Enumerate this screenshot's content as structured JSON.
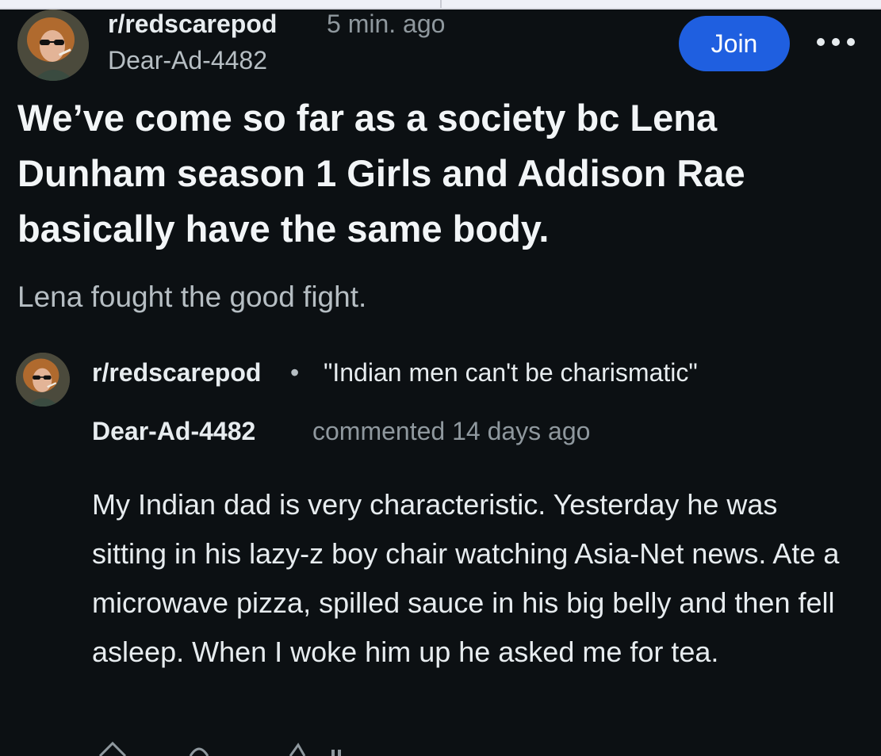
{
  "post": {
    "subreddit": "r/redscarepod",
    "time": "5 min. ago",
    "username": "Dear-Ad-4482",
    "join_label": "Join",
    "title": "We’ve come so far as a society bc Lena Dunham season 1 Girls and Addison Rae basically have the same body.",
    "body": "Lena fought the good fight."
  },
  "comment": {
    "subreddit": "r/redscarepod",
    "separator": "•",
    "post_title": "\"Indian men can't be charismatic\"",
    "username": "Dear-Ad-4482",
    "meta": "commented 14 days ago",
    "body": "My Indian dad is very characteristic. Yesterday he was sitting in his lazy-z boy chair watching Asia-Net news. Ate a microwave pizza, spilled sauce in his big belly and then fell asleep. When I woke him up he asked me for tea."
  },
  "icons": {
    "more": "more-options-icon",
    "upvote": "upvote-icon",
    "reply": "reply-icon",
    "award": "award-icon"
  },
  "colors": {
    "background": "#0c1013",
    "join_button": "#1f5fe0",
    "muted_text": "#8f989e"
  }
}
